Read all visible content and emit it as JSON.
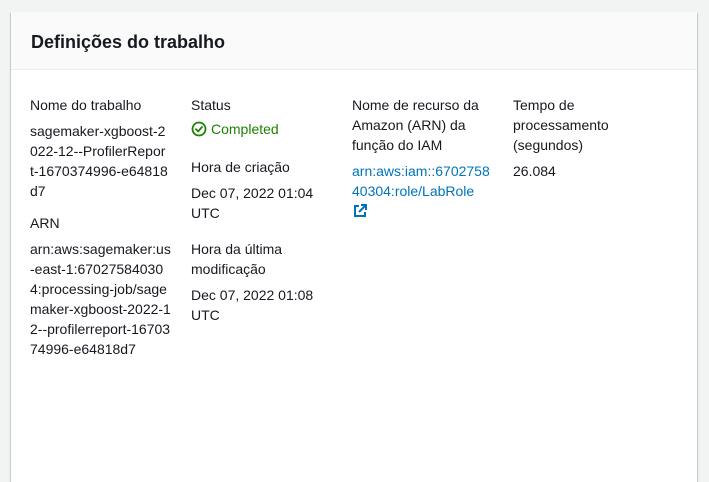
{
  "panel": {
    "title": "Definições do trabalho"
  },
  "fields": {
    "job_name": {
      "label": "Nome do trabalho",
      "value": "sagemaker-xgboost-2022-12--ProfilerReport-1670374996-e64818d7"
    },
    "arn": {
      "label": "ARN",
      "value": "arn:aws:sagemaker:us-east-1:670275840304:processing-job/sagemaker-xgboost-2022-12--profilerreport-1670374996-e64818d7"
    },
    "status": {
      "label": "Status",
      "value": "Completed",
      "icon": "check-circle-icon",
      "color": "#1d8102"
    },
    "creation_time": {
      "label": "Hora de criação",
      "value": "Dec 07, 2022 01:04 UTC"
    },
    "last_modified": {
      "label": "Hora da última modificação",
      "value": "Dec 07, 2022 01:08 UTC"
    },
    "iam_role": {
      "label": "Nome de recurso da Amazon (ARN) da função do IAM",
      "value": "arn:aws:iam::670275840304:role/LabRole",
      "icon": "external-link-icon",
      "color": "#0073bb"
    },
    "processing_time": {
      "label": "Tempo de processamento (segundos)",
      "value": "26.084"
    }
  }
}
